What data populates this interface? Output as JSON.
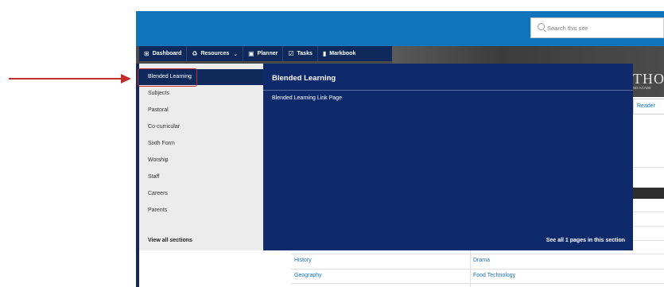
{
  "search": {
    "placeholder": "Search this site"
  },
  "navbar": {
    "items": [
      {
        "icon": "grid-icon",
        "glyph": "⊞",
        "label": "Dashboard"
      },
      {
        "icon": "resources-icon",
        "glyph": "♻",
        "label": "Resources",
        "caret": "⌄"
      },
      {
        "icon": "calendar-icon",
        "glyph": "▣",
        "label": "Planner"
      },
      {
        "icon": "checkbox-icon",
        "glyph": "☑",
        "label": "Tasks"
      },
      {
        "icon": "book-icon",
        "glyph": "▮",
        "label": "Markbook"
      }
    ]
  },
  "dropdown": {
    "sections": [
      "Blended Learning",
      "Subjects",
      "Pastoral",
      "Co-curricular",
      "Sixth Form",
      "Worship",
      "Staff",
      "Careers",
      "Parents"
    ],
    "view_all": "View all sections",
    "panel_title": "Blended Learning",
    "panel_link": "Blended Learning Link Page",
    "see_all": "See all 1 pages in this section"
  },
  "background": {
    "school_name_partial": "THOM",
    "school_sub_partial": "ND ACADE",
    "reader_label": "Reader",
    "table": [
      [
        "History",
        "Drama"
      ],
      [
        "Geography",
        "Food Technology"
      ]
    ]
  },
  "colors": {
    "header_blue": "#0f75bb",
    "nav_navy": "#0f2a5a",
    "panel_navy": "#0f2a6b",
    "annotation_red": "#c42b2b"
  }
}
